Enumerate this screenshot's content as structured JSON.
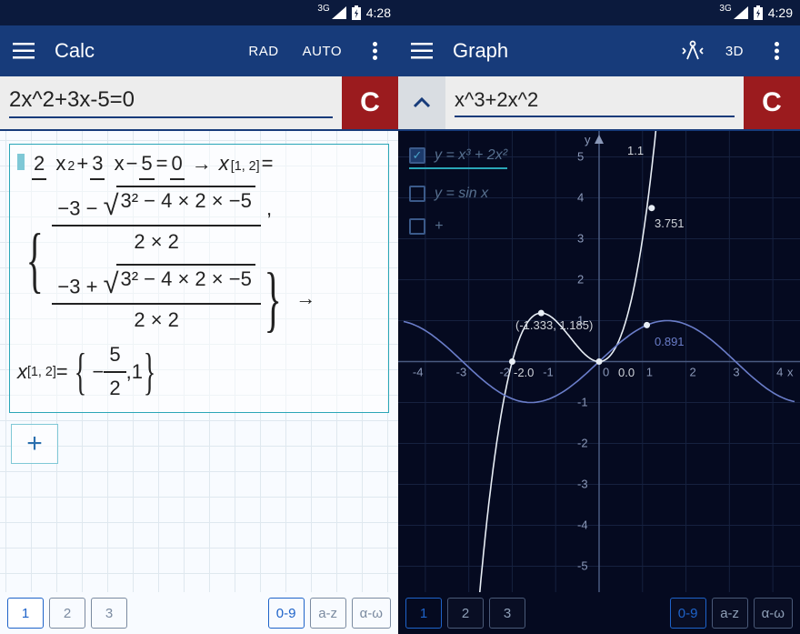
{
  "left": {
    "status": {
      "network": "3G",
      "time": "4:28"
    },
    "appbar": {
      "title": "Calc",
      "mode_angle": "RAD",
      "mode_auto": "AUTO"
    },
    "input": {
      "expression": "2x^2+3x-5=0",
      "clear_label": "C"
    },
    "work": {
      "line1_parts": {
        "a": "2",
        "var1": "x",
        "exp1": "2",
        "plus": " + ",
        "b": "3",
        "var2": "x",
        "minus_c": " − ",
        "c": "5",
        "eq": " = ",
        "zero": "0",
        "arrow": "→",
        "xlabel": "x",
        "xsub": "[1, 2]",
        "eqs": " ="
      },
      "quad": {
        "neg_b": "−3",
        "sqrt_inner": "3² − 4 × 2 × −5",
        "denom": "2 × 2"
      },
      "result": {
        "xlabel": "x",
        "xsub": "[1, 2]",
        "eq": " = ",
        "sol1_num": "5",
        "sol1_den": "2",
        "sol1_neg": "−",
        "comma": ", ",
        "sol2": "1"
      }
    },
    "tabs": {
      "t1": "1",
      "t2": "2",
      "t3": "3",
      "mode_num": "0-9",
      "mode_az": "a-z",
      "mode_gr": "α-ω"
    }
  },
  "right": {
    "status": {
      "network": "3G",
      "time": "4:29"
    },
    "appbar": {
      "title": "Graph",
      "mode_3d": "3D"
    },
    "input": {
      "expression": "x^3+2x^2",
      "clear_label": "C"
    },
    "legend": {
      "f1": "y = x³ + 2x²",
      "f2": "y = sin x",
      "add": "+"
    },
    "axes": {
      "y_label": "y",
      "x_label": "x"
    },
    "points": {
      "p1": "1.1",
      "p2": "3.751",
      "p3": "(-1.333, 1.185)",
      "p4": "-2.0",
      "p5": "0.0",
      "p6": "0.891"
    },
    "tabs": {
      "t1": "1",
      "t2": "2",
      "t3": "3",
      "mode_num": "0-9",
      "mode_az": "a-z",
      "mode_gr": "α-ω"
    }
  },
  "chart_data": {
    "type": "line",
    "title": "",
    "xlabel": "x",
    "ylabel": "y",
    "xlim": [
      -4.5,
      4.5
    ],
    "ylim": [
      -5.5,
      5.5
    ],
    "x_ticks": [
      -4,
      -3,
      -2,
      -1,
      0,
      1,
      2,
      3,
      4
    ],
    "y_ticks": [
      -5,
      -4,
      -3,
      -2,
      -1,
      0,
      1,
      2,
      3,
      4,
      5
    ],
    "series": [
      {
        "name": "y = x^3 + 2x^2",
        "color": "#e8eef5",
        "x": [
          -2.5,
          -2.0,
          -1.667,
          -1.333,
          -1.0,
          -0.5,
          0.0,
          0.5,
          1.0,
          1.211,
          1.5
        ],
        "values": [
          -3.125,
          0.0,
          0.926,
          1.185,
          1.0,
          0.375,
          0.0,
          0.625,
          3.0,
          3.751,
          7.875
        ]
      },
      {
        "name": "y = sin x",
        "color": "#6a7dc9",
        "x": [
          -4.5,
          -4.0,
          -3.5,
          -3.0,
          -2.5,
          -2.0,
          -1.571,
          -1.0,
          -0.5,
          0.0,
          0.5,
          1.0,
          1.1,
          1.571,
          2.0,
          2.5,
          3.0,
          3.5,
          4.0,
          4.5
        ],
        "values": [
          0.978,
          0.757,
          0.351,
          -0.141,
          -0.599,
          -0.909,
          -1.0,
          -0.841,
          -0.479,
          0.0,
          0.479,
          0.841,
          0.891,
          1.0,
          0.909,
          0.599,
          0.141,
          -0.351,
          -0.757,
          -0.978
        ]
      }
    ],
    "annotations": [
      {
        "x": -2.0,
        "y": 0.0,
        "text": "-2.0"
      },
      {
        "x": 0.0,
        "y": 0.0,
        "text": "0.0"
      },
      {
        "x": -1.333,
        "y": 1.185,
        "text": "(-1.333, 1.185)"
      },
      {
        "x": 1.211,
        "y": 3.751,
        "text": "3.751"
      },
      {
        "x": 1.1,
        "y": 0.891,
        "text": "0.891"
      },
      {
        "x": 0.0,
        "y": 5.3,
        "text": "1.1"
      }
    ]
  }
}
